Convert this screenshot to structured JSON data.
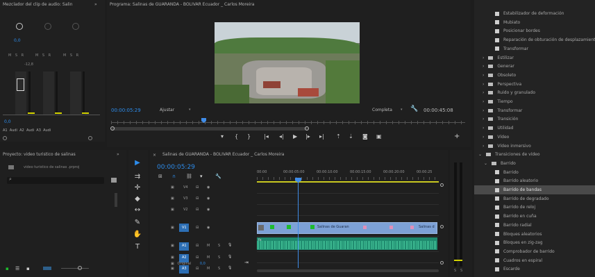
{
  "audio_mixer": {
    "title": "Mezclador del clip de audio: Salin",
    "db_value": "0,0",
    "db_scale": [
      "-12,8",
      "-18",
      "-24",
      "-30",
      "-36",
      "-42",
      "-48",
      "-54"
    ],
    "channels": [
      "A1",
      "Audi",
      "A2",
      "Audi",
      "A3",
      "Audi"
    ],
    "msr": "M S R"
  },
  "program": {
    "title": "Programa: Salinas de GUARANDA - BOLIVAR Ecuador _ Carlos Moreira",
    "timecode": "00:00:05:29",
    "fit": "Ajustar",
    "quality": "Completa",
    "duration": "00:00:45:08",
    "scrub_position": 0.27
  },
  "project": {
    "title": "Proyecto: video turistico de salinas",
    "file": "video turistico de salinas .prproj"
  },
  "timeline": {
    "tab_title": "Salinas de GUARANDA - BOLIVAR Ecuador _ Carlos Moreira",
    "timecode": "00:00:05:29",
    "ruler": [
      "00:00",
      "00:00:05:00",
      "00:00:10:00",
      "00:00:15:00",
      "00:00:20:00",
      "00:00:25"
    ],
    "video_tracks": [
      "V4",
      "V3",
      "V2",
      "V1"
    ],
    "audio_tracks": [
      "A1",
      "A2",
      "A3"
    ],
    "master": "Original",
    "master_val": "0,0",
    "clip_label_1": "Salinas de Guaran",
    "clip_label_2": "Salinas d",
    "fx": "fx",
    "playhead_position": 0.2
  },
  "effects": {
    "top_items": [
      "Estabilizador de deformación",
      "Mubiato",
      "Posicionar bordes",
      "Reparación de obturación de desplazamiento",
      "Transformar"
    ],
    "folders": [
      "Estilizar",
      "Generar",
      "Obsoleto",
      "Perspectiva",
      "Ruido y granulado",
      "Tiempo",
      "Transformar",
      "Transición",
      "Utilidad",
      "Vídeo",
      "Vídeo inmersivo"
    ],
    "transitions_folder": "Transiciones de vídeo",
    "barrido_folder": "Barrido",
    "barrido_items": [
      "Barrido",
      "Barrido aleatorio",
      "Barrido de bandas",
      "Barrido de degradado",
      "Barrido de reloj",
      "Barrido en cuña",
      "Barrido radial",
      "Bloques aleatorios",
      "Bloques en zig-zag",
      "Comprobador de barrido",
      "Cuadros en espiral",
      "Escarde"
    ],
    "selected_index": 2
  },
  "meter": {
    "labels": [
      "S",
      "S"
    ]
  },
  "colors": {
    "accent": "#2d8ceb",
    "clip_video": "#7da1d6",
    "clip_audio": "#1f8a6e",
    "playhead": "#3f8ce8"
  }
}
